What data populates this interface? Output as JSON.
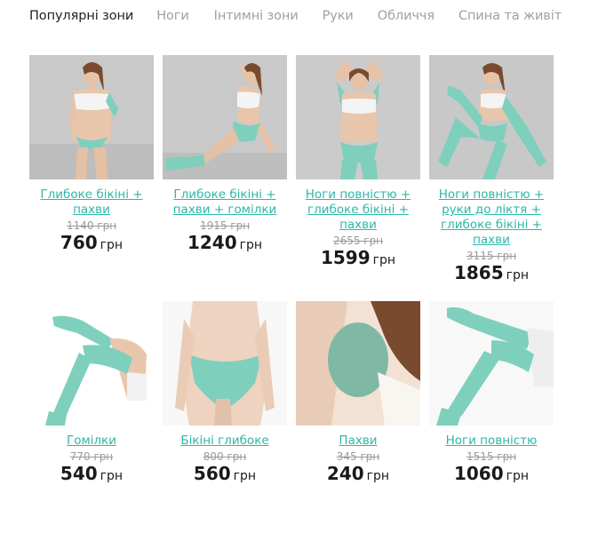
{
  "tabs": [
    {
      "label": "Популярні зони",
      "active": true
    },
    {
      "label": "Ноги",
      "active": false
    },
    {
      "label": "Інтимні зони",
      "active": false
    },
    {
      "label": "Руки",
      "active": false
    },
    {
      "label": "Обличчя",
      "active": false
    },
    {
      "label": "Спина та живіт",
      "active": false
    }
  ],
  "currency": "грн",
  "colors": {
    "accent": "#2db7a7",
    "highlight": "#7fcfbd"
  },
  "products": [
    {
      "title": "Глибоке бікіні + пахви",
      "old_price": "1140 грн",
      "price": "760",
      "currency": "грн",
      "image": "woman-standing-photo"
    },
    {
      "title": "Глибоке бікіні + пахви + гомілки",
      "old_price": "1915 грн",
      "price": "1240",
      "currency": "грн",
      "image": "woman-sitting-photo"
    },
    {
      "title": "Ноги повністю + глибоке бікіні + пахви",
      "old_price": "2655 грн",
      "price": "1599",
      "currency": "грн",
      "image": "woman-arms-raised-photo"
    },
    {
      "title": "Ноги повністю + руки до ліктя + глибоке бікіні + пахви",
      "old_price": "3115 грн",
      "price": "1865",
      "currency": "грн",
      "image": "woman-seated-legs-photo"
    },
    {
      "title": "Гомілки",
      "old_price": "770 грн",
      "price": "540",
      "currency": "грн",
      "image": "legs-photo"
    },
    {
      "title": "Бікіні глибоке",
      "old_price": "800 грн",
      "price": "560",
      "currency": "грн",
      "image": "bikini-zone-photo"
    },
    {
      "title": "Пахви",
      "old_price": "345 грн",
      "price": "240",
      "currency": "грн",
      "image": "armpit-photo"
    },
    {
      "title": "Ноги повністю",
      "old_price": "1515 грн",
      "price": "1060",
      "currency": "грн",
      "image": "full-legs-photo"
    }
  ]
}
